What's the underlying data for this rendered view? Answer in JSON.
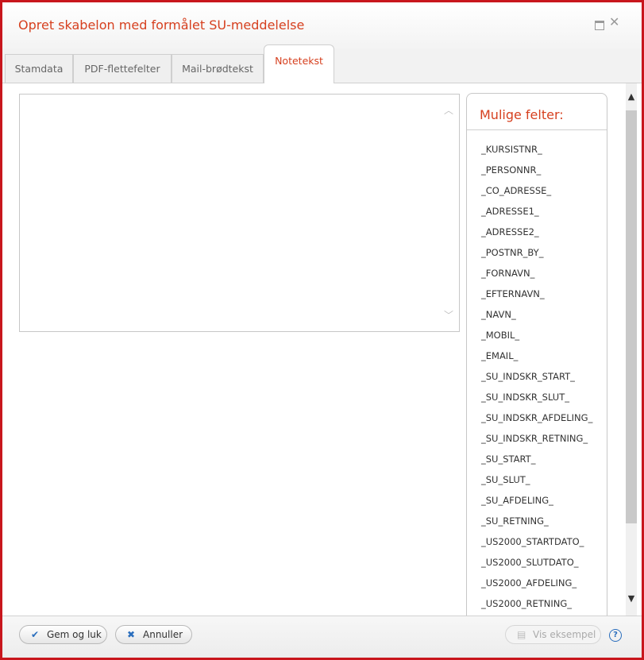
{
  "dialog": {
    "title": "Opret skabelon med formålet SU-meddelelse"
  },
  "tabs": [
    {
      "label": "Stamdata",
      "active": false
    },
    {
      "label": "PDF-flettefelter",
      "active": false
    },
    {
      "label": "Mail-brødtekst",
      "active": false
    },
    {
      "label": "Notetekst",
      "active": true
    }
  ],
  "note_text": {
    "value": ""
  },
  "fields_panel": {
    "title": "Mulige felter:",
    "items": [
      "_KURSISTNR_",
      "_PERSONNR_",
      "_CO_ADRESSE_",
      "_ADRESSE1_",
      "_ADRESSE2_",
      "_POSTNR_BY_",
      "_FORNAVN_",
      "_EFTERNAVN_",
      "_NAVN_",
      "_MOBIL_",
      "_EMAIL_",
      "_SU_INDSKR_START_",
      "_SU_INDSKR_SLUT_",
      "_SU_INDSKR_AFDELING_",
      "_SU_INDSKR_RETNING_",
      "_SU_START_",
      "_SU_SLUT_",
      "_SU_AFDELING_",
      "_SU_RETNING_",
      "_US2000_STARTDATO_",
      "_US2000_SLUTDATO_",
      "_US2000_AFDELING_",
      "_US2000_RETNING_"
    ]
  },
  "footer": {
    "save_label": "Gem og luk",
    "cancel_label": "Annuller",
    "preview_label": "Vis eksempel",
    "help": "?"
  },
  "colors": {
    "accent": "#d6401f",
    "border": "#c8161d"
  }
}
